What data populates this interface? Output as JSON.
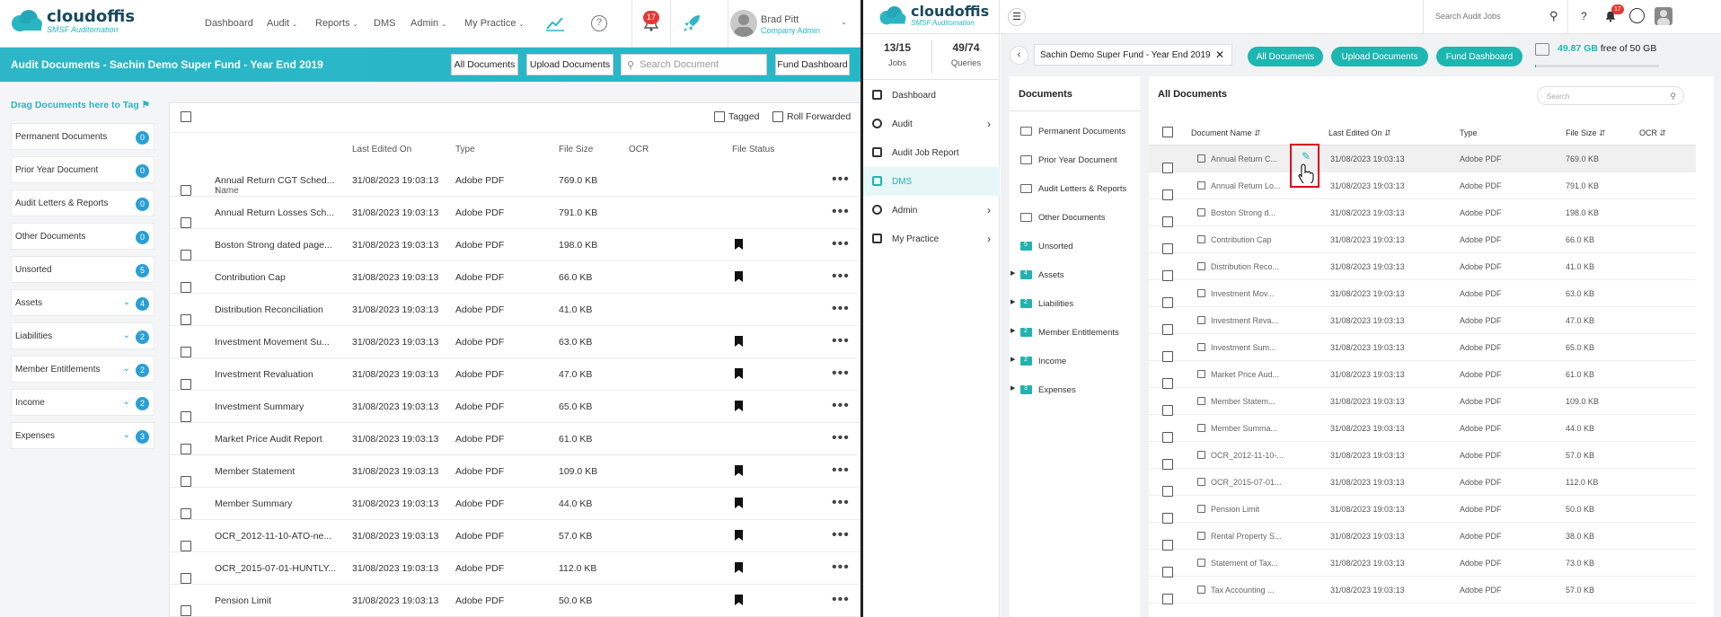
{
  "left": {
    "logo": {
      "name": "cloudoffis",
      "tagline": "SMSF Auditomation"
    },
    "nav": [
      "Dashboard",
      "Audit",
      "Reports",
      "DMS",
      "Admin",
      "My Practice"
    ],
    "notification_count": "17",
    "user": {
      "name": "Brad Pitt",
      "role": "Company Admin"
    },
    "page_title": "Audit Documents - Sachin Demo Super Fund - Year End 2019",
    "buttons": {
      "all_documents": "All Documents",
      "upload_documents": "Upload Documents",
      "fund_dashboard": "Fund Dashboard"
    },
    "search_placeholder": "Search Document",
    "drag_header": "Drag Documents here to Tag",
    "categories": [
      {
        "label": "Permanent Documents",
        "count": "0"
      },
      {
        "label": "Prior Year Document",
        "count": "0"
      },
      {
        "label": "Audit Letters & Reports",
        "count": "0"
      },
      {
        "label": "Other Documents",
        "count": "0"
      },
      {
        "label": "Unsorted",
        "count": "5"
      },
      {
        "label": "Assets",
        "count": "4"
      },
      {
        "label": "Liabilities",
        "count": "2"
      },
      {
        "label": "Member Entitlements",
        "count": "2"
      },
      {
        "label": "Income",
        "count": "2"
      },
      {
        "label": "Expenses",
        "count": "3"
      }
    ],
    "filters": {
      "tagged": "Tagged",
      "roll_forwarded": "Roll Forwarded"
    },
    "columns": [
      "Name",
      "Last Edited On",
      "Type",
      "File Size",
      "OCR",
      "File Status"
    ],
    "rows": [
      {
        "name": "Annual Return CGT Sched...",
        "date": "31/08/2023 19:03:13",
        "type": "Adobe PDF",
        "size": "769.0 KB",
        "bookmark": false
      },
      {
        "name": "Annual Return Losses Sch...",
        "date": "31/08/2023 19:03:13",
        "type": "Adobe PDF",
        "size": "791.0 KB",
        "bookmark": false
      },
      {
        "name": "Boston Strong dated page...",
        "date": "31/08/2023 19:03:13",
        "type": "Adobe PDF",
        "size": "198.0 KB",
        "bookmark": true
      },
      {
        "name": "Contribution Cap",
        "date": "31/08/2023 19:03:13",
        "type": "Adobe PDF",
        "size": "66.0 KB",
        "bookmark": true
      },
      {
        "name": "Distribution Reconciliation",
        "date": "31/08/2023 19:03:13",
        "type": "Adobe PDF",
        "size": "41.0 KB",
        "bookmark": false
      },
      {
        "name": "Investment Movement Su...",
        "date": "31/08/2023 19:03:13",
        "type": "Adobe PDF",
        "size": "63.0 KB",
        "bookmark": true
      },
      {
        "name": "Investment Revaluation",
        "date": "31/08/2023 19:03:13",
        "type": "Adobe PDF",
        "size": "47.0 KB",
        "bookmark": true
      },
      {
        "name": "Investment Summary",
        "date": "31/08/2023 19:03:13",
        "type": "Adobe PDF",
        "size": "65.0 KB",
        "bookmark": true
      },
      {
        "name": "Market Price Audit Report",
        "date": "31/08/2023 19:03:13",
        "type": "Adobe PDF",
        "size": "61.0 KB",
        "bookmark": false
      },
      {
        "name": "Member Statement",
        "date": "31/08/2023 19:03:13",
        "type": "Adobe PDF",
        "size": "109.0 KB",
        "bookmark": true
      },
      {
        "name": "Member Summary",
        "date": "31/08/2023 19:03:13",
        "type": "Adobe PDF",
        "size": "44.0 KB",
        "bookmark": true
      },
      {
        "name": "OCR_2012-11-10-ATO-ne...",
        "date": "31/08/2023 19:03:13",
        "type": "Adobe PDF",
        "size": "57.0 KB",
        "bookmark": true
      },
      {
        "name": "OCR_2015-07-01-HUNTLY...",
        "date": "31/08/2023 19:03:13",
        "type": "Adobe PDF",
        "size": "112.0 KB",
        "bookmark": true
      },
      {
        "name": "Pension Limit",
        "date": "31/08/2023 19:03:13",
        "type": "Adobe PDF",
        "size": "50.0 KB",
        "bookmark": true
      }
    ]
  },
  "right": {
    "logo": {
      "name": "cloudoffis",
      "tagline": "SMSF Auditomation"
    },
    "search_placeholder": "Search Audit Jobs",
    "notification_count": "17",
    "stats": [
      {
        "value": "13/15",
        "label": "Jobs"
      },
      {
        "value": "49/74",
        "label": "Queries"
      }
    ],
    "sidebar": [
      {
        "label": "Dashboard",
        "arrow": false
      },
      {
        "label": "Audit",
        "arrow": true
      },
      {
        "label": "Audit Job Report",
        "arrow": false
      },
      {
        "label": "DMS",
        "arrow": false
      },
      {
        "label": "Admin",
        "arrow": true
      },
      {
        "label": "My Practice",
        "arrow": true
      }
    ],
    "fund_chip": "Sachin Demo Super Fund - Year End 2019",
    "buttons": {
      "all_documents": "All Documents",
      "upload_documents": "Upload Documents",
      "fund_dashboard": "Fund Dashboard"
    },
    "storage": {
      "used": "49.87 GB",
      "text": "free of 50 GB",
      "fraction": 0.0026
    },
    "documents_title": "Documents",
    "doc_tree": [
      {
        "label": "Permanent Documents",
        "count": "",
        "expand": false,
        "filled": false
      },
      {
        "label": "Prior Year Document",
        "count": "",
        "expand": false,
        "filled": false
      },
      {
        "label": "Audit Letters & Reports",
        "count": "",
        "expand": false,
        "filled": false
      },
      {
        "label": "Other Documents",
        "count": "",
        "expand": false,
        "filled": false
      },
      {
        "label": "Unsorted",
        "count": "5",
        "expand": false,
        "filled": true
      },
      {
        "label": "Assets",
        "count": "4",
        "expand": true,
        "filled": true
      },
      {
        "label": "Liabilities",
        "count": "2",
        "expand": true,
        "filled": true
      },
      {
        "label": "Member Entitlements",
        "count": "2",
        "expand": true,
        "filled": true
      },
      {
        "label": "Income",
        "count": "2",
        "expand": true,
        "filled": true
      },
      {
        "label": "Expenses",
        "count": "3",
        "expand": true,
        "filled": true
      }
    ],
    "all_docs_title": "All Documents",
    "all_docs_search": "Search",
    "columns": [
      "Document Name",
      "Last Edited On",
      "Type",
      "File Size",
      "OCR"
    ],
    "rows": [
      {
        "name": "Annual Return C...",
        "date": "31/08/2023 19:03:13",
        "type": "Adobe PDF",
        "size": "769.0 KB"
      },
      {
        "name": "Annual Return Lo...",
        "date": "31/08/2023 19:03:13",
        "type": "Adobe PDF",
        "size": "791.0 KB"
      },
      {
        "name": "Boston Strong d...",
        "date": "31/08/2023 19:03:13",
        "type": "Adobe PDF",
        "size": "198.0 KB"
      },
      {
        "name": "Contribution Cap",
        "date": "31/08/2023 19:03:13",
        "type": "Adobe PDF",
        "size": "66.0 KB"
      },
      {
        "name": "Distribution Reco...",
        "date": "31/08/2023 19:03:13",
        "type": "Adobe PDF",
        "size": "41.0 KB"
      },
      {
        "name": "Investment Mov...",
        "date": "31/08/2023 19:03:13",
        "type": "Adobe PDF",
        "size": "63.0 KB"
      },
      {
        "name": "Investment Reva...",
        "date": "31/08/2023 19:03:13",
        "type": "Adobe PDF",
        "size": "47.0 KB"
      },
      {
        "name": "Investment Sum...",
        "date": "31/08/2023 19:03:13",
        "type": "Adobe PDF",
        "size": "65.0 KB"
      },
      {
        "name": "Market Price Aud...",
        "date": "31/08/2023 19:03:13",
        "type": "Adobe PDF",
        "size": "61.0 KB"
      },
      {
        "name": "Member Statem...",
        "date": "31/08/2023 19:03:13",
        "type": "Adobe PDF",
        "size": "109.0 KB"
      },
      {
        "name": "Member Summa...",
        "date": "31/08/2023 19:03:13",
        "type": "Adobe PDF",
        "size": "44.0 KB"
      },
      {
        "name": "OCR_2012-11-10-...",
        "date": "31/08/2023 19:03:13",
        "type": "Adobe PDF",
        "size": "57.0 KB"
      },
      {
        "name": "OCR_2015-07-01...",
        "date": "31/08/2023 19:03:13",
        "type": "Adobe PDF",
        "size": "112.0 KB"
      },
      {
        "name": "Pension Limit",
        "date": "31/08/2023 19:03:13",
        "type": "Adobe PDF",
        "size": "50.0 KB"
      },
      {
        "name": "Rental Property S...",
        "date": "31/08/2023 19:03:13",
        "type": "Adobe PDF",
        "size": "38.0 KB"
      },
      {
        "name": "Statement of Tax...",
        "date": "31/08/2023 19:03:13",
        "type": "Adobe PDF",
        "size": "73.0 KB"
      },
      {
        "name": "Tax Accounting ...",
        "date": "31/08/2023 19:03:13",
        "type": "Adobe PDF",
        "size": "57.0 KB"
      }
    ]
  },
  "colors": {
    "teal": "#2cb6c7",
    "pill": "#1eb6b0",
    "badge_blue": "#2a9fd6",
    "red_badge": "#e53935",
    "highlight": "#e0001b"
  }
}
